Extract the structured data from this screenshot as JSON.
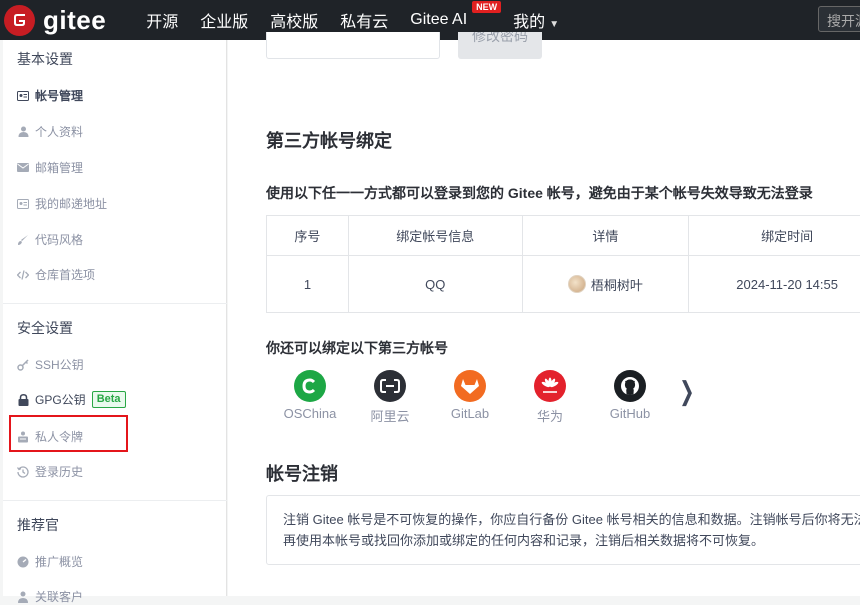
{
  "topnav": {
    "logo_text": "gitee",
    "items": [
      "开源",
      "企业版",
      "高校版",
      "私有云"
    ],
    "ai_label": "Gitee AI",
    "new_badge": "NEW",
    "mine_label": "我的",
    "search_placeholder": "搜开源"
  },
  "sidebar": {
    "basic_title": "基本设置",
    "basic_items": [
      "帐号管理",
      "个人资料",
      "邮箱管理",
      "我的邮递地址",
      "代码风格",
      "仓库首选项"
    ],
    "security_title": "安全设置",
    "security_items": [
      "SSH公钥",
      "GPG公钥",
      "私人令牌",
      "登录历史"
    ],
    "beta_badge": "Beta",
    "promo_title": "推荐官",
    "promo_items": [
      "推广概览",
      "关联客户"
    ]
  },
  "main": {
    "change_password_button": "修改密码",
    "third_party_title": "第三方帐号绑定",
    "third_party_desc": "使用以下任一一方式都可以登录到您的 Gitee 帐号，避免由于某个帐号失效导致无法登录",
    "table": {
      "headers": [
        "序号",
        "绑定帐号信息",
        "详情",
        "绑定时间"
      ],
      "rows": [
        {
          "index": "1",
          "account": "QQ",
          "detail": "梧桐树叶",
          "time": "2024-11-20 14:55"
        }
      ]
    },
    "also_bind_title": "你还可以绑定以下第三方帐号",
    "providers": [
      {
        "name": "OSChina",
        "color": "#1da745",
        "icon": "oschina-icon"
      },
      {
        "name": "阿里云",
        "color": "#2c2f36",
        "icon": "aliyun-icon"
      },
      {
        "name": "GitLab",
        "color": "#f26b21",
        "icon": "gitlab-icon"
      },
      {
        "name": "华为",
        "color": "#e3212c",
        "icon": "huawei-icon"
      },
      {
        "name": "GitHub",
        "color": "#1b1f23",
        "icon": "github-icon"
      }
    ],
    "cancel_title": "帐号注销",
    "cancel_notice": "注销 Gitee 帐号是不可恢复的操作，你应自行备份 Gitee 帐号相关的信息和数据。注销帐号后你将无法再使用本帐号或找回你添加或绑定的任何内容和记录，注销后相关数据将不可恢复。"
  }
}
